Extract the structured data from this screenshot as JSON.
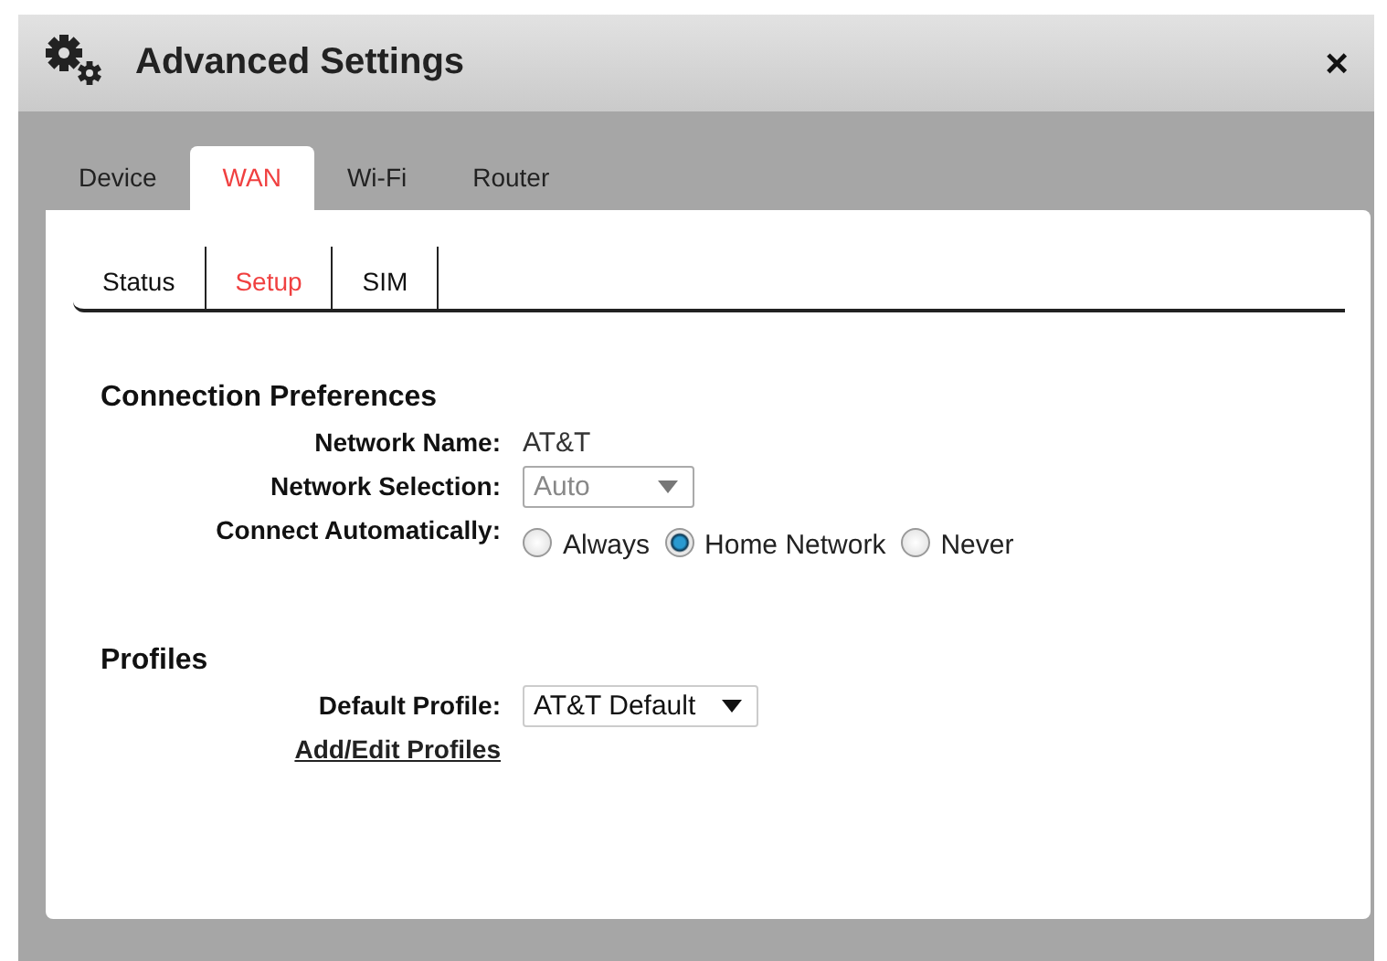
{
  "window": {
    "title": "Advanced Settings",
    "close": "×"
  },
  "tabs": [
    {
      "label": "Device",
      "selected": false
    },
    {
      "label": "WAN",
      "selected": true
    },
    {
      "label": "Wi-Fi",
      "selected": false
    },
    {
      "label": "Router",
      "selected": false
    }
  ],
  "subtabs": [
    {
      "label": "Status",
      "selected": false
    },
    {
      "label": "Setup",
      "selected": true
    },
    {
      "label": "SIM",
      "selected": false
    }
  ],
  "sections": [
    {
      "title": "Connection Preferences",
      "rows": [
        {
          "kind": "text",
          "label": "Network Name:",
          "value": "AT&T"
        },
        {
          "kind": "select",
          "label": "Network Selection:",
          "value": "Auto",
          "disabled": true
        },
        {
          "kind": "radio",
          "label": "Connect Automatically:",
          "options": [
            {
              "label": "Always",
              "selected": false
            },
            {
              "label": "Home Network",
              "selected": true
            },
            {
              "label": "Never",
              "selected": false
            }
          ]
        }
      ]
    },
    {
      "title": "Profiles",
      "rows": [
        {
          "kind": "select",
          "label": "Default Profile:",
          "value": "AT&T Default",
          "disabled": false
        },
        {
          "kind": "link",
          "label": "Add/Edit Profiles"
        }
      ]
    }
  ]
}
